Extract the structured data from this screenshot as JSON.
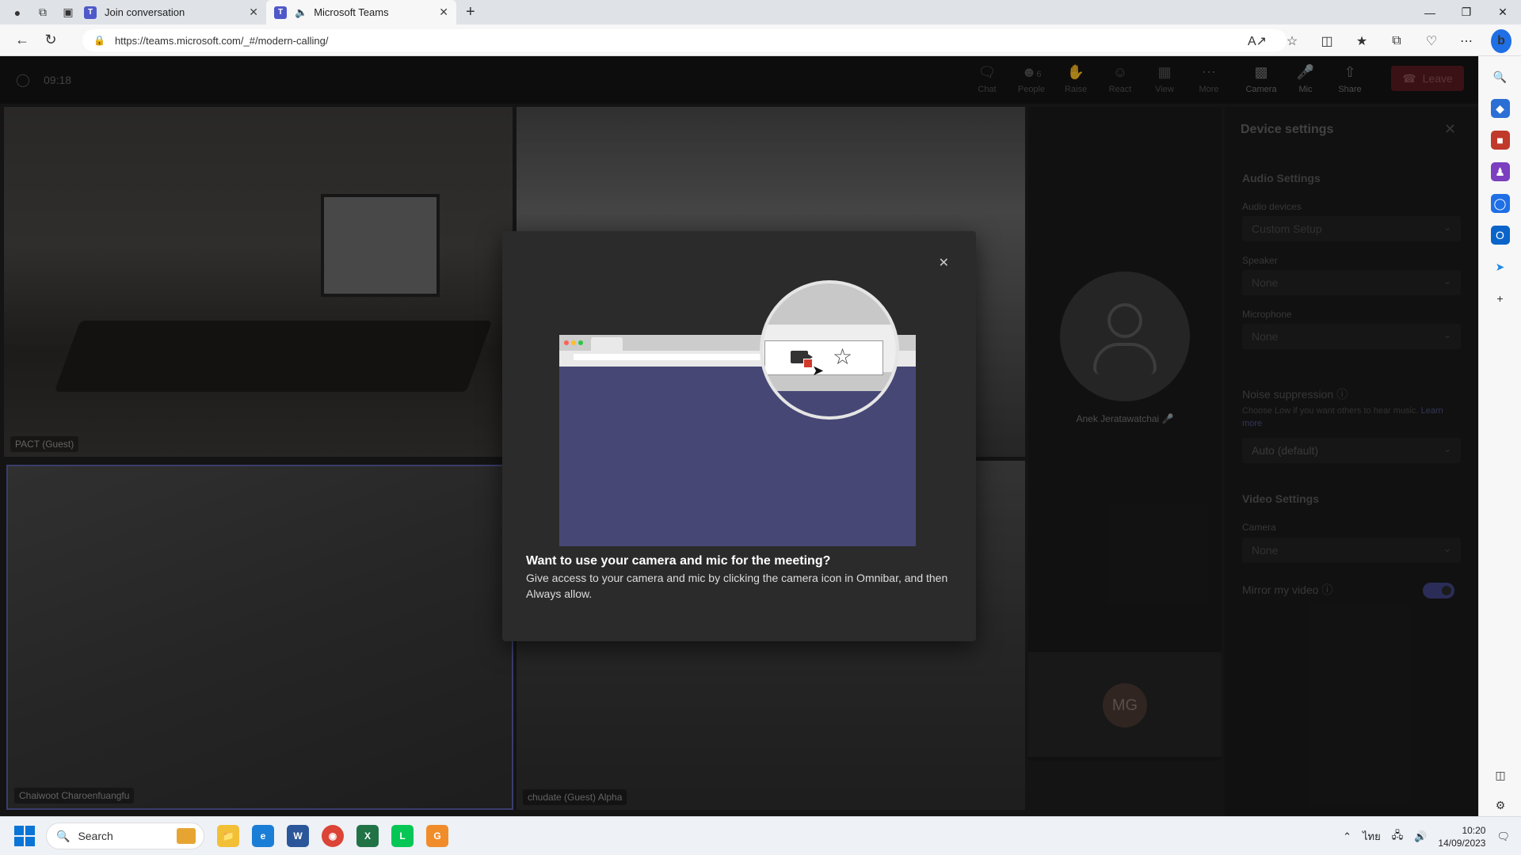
{
  "browser": {
    "tabs": [
      {
        "label": "Join conversation",
        "active": false
      },
      {
        "label": "Microsoft Teams",
        "active": true
      }
    ],
    "url": "https://teams.microsoft.com/_#/modern-calling/"
  },
  "meeting": {
    "time": "09:18",
    "controls": [
      {
        "label": "Chat",
        "icon": "chat-icon"
      },
      {
        "label": "People",
        "icon": "people-icon",
        "count": "6"
      },
      {
        "label": "Raise",
        "icon": "hand-icon"
      },
      {
        "label": "React",
        "icon": "smile-icon"
      },
      {
        "label": "View",
        "icon": "grid-icon"
      },
      {
        "label": "More",
        "icon": "more-icon"
      },
      {
        "label": "Camera",
        "icon": "camera-off-icon"
      },
      {
        "label": "Mic",
        "icon": "mic-off-icon"
      },
      {
        "label": "Share",
        "icon": "share-icon"
      }
    ],
    "leave_label": "Leave",
    "participants": {
      "tile1": "PACT (Guest)",
      "tile3": "Chaiwoot Charoenfuangfu",
      "tile4": "chudate (Guest) Alpha",
      "side": "Anek Jeratawatchai",
      "mg_initials": "MG"
    }
  },
  "device_settings": {
    "title": "Device settings",
    "audio_heading": "Audio Settings",
    "audio_devices_label": "Audio devices",
    "audio_devices_value": "Custom Setup",
    "speaker_label": "Speaker",
    "speaker_value": "None",
    "microphone_label": "Microphone",
    "microphone_value": "None",
    "noise_label": "Noise suppression",
    "noise_help": "Choose Low if you want others to hear music.",
    "noise_link": "Learn more",
    "noise_value": "Auto (default)",
    "video_heading": "Video Settings",
    "camera_label": "Camera",
    "camera_value": "None",
    "mirror_label": "Mirror my video",
    "mirror_on": true
  },
  "dialog": {
    "title": "Want to use your camera and mic for the meeting?",
    "body": "Give access to your camera and mic by clicking the camera icon in Omnibar, and then Always allow."
  },
  "taskbar": {
    "search_placeholder": "Search",
    "lang": "ไทย",
    "time": "10:20",
    "date": "14/09/2023"
  }
}
